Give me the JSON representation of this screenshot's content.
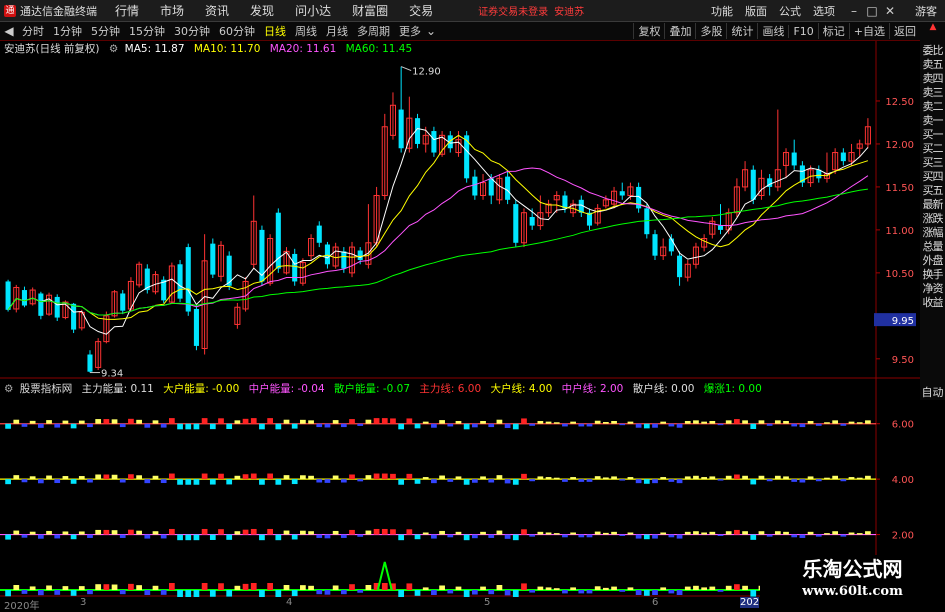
{
  "window": {
    "app_title": "通达信金融终端",
    "menus": [
      "行情",
      "市场",
      "资讯",
      "发现",
      "问小达",
      "财富圈",
      "交易"
    ],
    "notice": "证券交易未登录",
    "notice_stock": "安迪苏",
    "right_menus": [
      "功能",
      "版面",
      "公式",
      "选项"
    ],
    "guest": "游客",
    "logo_glyph": "通"
  },
  "periods": {
    "items": [
      "分时",
      "1分钟",
      "5分钟",
      "15分钟",
      "30分钟",
      "60分钟",
      "日线",
      "周线",
      "月线",
      "多周期",
      "更多"
    ],
    "active": "日线",
    "toolbar": [
      "复权",
      "叠加",
      "多股",
      "统计",
      "画线",
      "F10",
      "标记",
      "+自选",
      "返回"
    ]
  },
  "sidebar": {
    "items": [
      "委比",
      "卖五",
      "卖四",
      "卖三",
      "卖二",
      "卖一",
      "买一",
      "买二",
      "买三",
      "买四",
      "买五",
      "最新",
      "涨跌",
      "涨幅",
      "总量",
      "外盘",
      "换手",
      "净资",
      "收益"
    ],
    "auto": "自动"
  },
  "legend_main": {
    "stock": "安迪苏(日线 前复权)",
    "ma5": "MA5: 11.87",
    "ma10": "MA10: 11.70",
    "ma20": "MA20: 11.61",
    "ma60": "MA60: 11.45"
  },
  "legend_indicator": {
    "name": "股票指标网",
    "items": [
      {
        "label": "主力能量: 0.11",
        "color": "#dddddd"
      },
      {
        "label": "大户能量: -0.00",
        "color": "#ffff00"
      },
      {
        "label": "中户能量: -0.04",
        "color": "#ff55ff"
      },
      {
        "label": "散户能量: -0.07",
        "color": "#00ff00"
      },
      {
        "label": "主力线: 6.00",
        "color": "#ff3333"
      },
      {
        "label": "大户线: 4.00",
        "color": "#ffff00"
      },
      {
        "label": "中户线: 2.00",
        "color": "#ff55ff"
      },
      {
        "label": "散户线: 0.00",
        "color": "#dddddd"
      },
      {
        "label": "爆涨1: 0.00",
        "color": "#00ff00"
      }
    ]
  },
  "date_axis": [
    "2020年",
    "3",
    "4",
    "5",
    "6",
    "202"
  ],
  "watermark": {
    "line1": "乐淘公式网",
    "line2": "www.60lt.com"
  },
  "colors": {
    "up": "#ff3333",
    "down": "#00e5ff",
    "ma5": "#ffffff",
    "ma10": "#ffff00",
    "ma20": "#ff55ff",
    "ma60": "#00ff00"
  },
  "chart_data": [
    {
      "type": "candlestick",
      "title": "安迪苏(日线 前复权)",
      "y_ticks": [
        12.5,
        12.0,
        11.5,
        11.0,
        10.5,
        9.95,
        9.5
      ],
      "ylim": [
        9.3,
        13.0
      ],
      "annotations": [
        {
          "label": "12.90",
          "index": 48,
          "value": 12.9
        },
        {
          "label": "9.34",
          "index": 10,
          "value": 9.34
        }
      ],
      "current_price": "9.95",
      "candles": [
        [
          10.4,
          10.07,
          10.42,
          10.05
        ],
        [
          10.08,
          10.33,
          10.36,
          10.04
        ],
        [
          10.3,
          10.12,
          10.34,
          10.1
        ],
        [
          10.14,
          10.3,
          10.33,
          10.12
        ],
        [
          10.26,
          10.0,
          10.28,
          9.96
        ],
        [
          10.02,
          10.24,
          10.27,
          10.0
        ],
        [
          10.22,
          9.98,
          10.25,
          9.94
        ],
        [
          9.98,
          10.16,
          10.18,
          9.96
        ],
        [
          10.14,
          9.84,
          10.15,
          9.8
        ],
        [
          9.86,
          10.04,
          10.07,
          9.83
        ],
        [
          9.55,
          9.35,
          9.6,
          9.34
        ],
        [
          9.4,
          9.7,
          9.74,
          9.37
        ],
        [
          9.7,
          10.0,
          10.05,
          9.68
        ],
        [
          10.0,
          10.28,
          10.3,
          9.98
        ],
        [
          10.26,
          10.06,
          10.3,
          10.02
        ],
        [
          10.08,
          10.4,
          10.45,
          10.05
        ],
        [
          10.36,
          10.6,
          10.63,
          10.33
        ],
        [
          10.55,
          10.3,
          10.6,
          10.26
        ],
        [
          10.28,
          10.48,
          10.52,
          10.25
        ],
        [
          10.42,
          10.18,
          10.46,
          10.15
        ],
        [
          10.16,
          10.58,
          10.62,
          10.14
        ],
        [
          10.6,
          10.2,
          10.65,
          10.16
        ],
        [
          10.8,
          10.05,
          10.84,
          10.0
        ],
        [
          10.08,
          9.65,
          10.12,
          9.6
        ],
        [
          9.62,
          10.64,
          10.95,
          9.55
        ],
        [
          10.84,
          10.48,
          10.9,
          10.44
        ],
        [
          10.46,
          10.82,
          10.87,
          10.4
        ],
        [
          10.7,
          10.35,
          10.75,
          10.3
        ],
        [
          9.9,
          10.1,
          10.15,
          9.85
        ],
        [
          10.08,
          10.4,
          10.45,
          10.05
        ],
        [
          10.6,
          11.1,
          11.4,
          10.55
        ],
        [
          11.0,
          10.4,
          11.05,
          10.35
        ],
        [
          10.38,
          10.9,
          10.95,
          10.35
        ],
        [
          11.2,
          10.55,
          11.25,
          10.5
        ],
        [
          10.5,
          10.75,
          10.8,
          10.48
        ],
        [
          10.72,
          10.4,
          10.78,
          10.35
        ],
        [
          10.38,
          10.62,
          10.67,
          10.35
        ],
        [
          10.7,
          10.9,
          10.95,
          10.65
        ],
        [
          11.05,
          10.85,
          11.1,
          10.8
        ],
        [
          10.83,
          10.6,
          10.86,
          10.55
        ],
        [
          10.58,
          10.8,
          10.85,
          10.55
        ],
        [
          10.75,
          10.55,
          10.8,
          10.5
        ],
        [
          10.5,
          10.8,
          10.86,
          10.45
        ],
        [
          10.76,
          10.65,
          10.8,
          10.6
        ],
        [
          10.6,
          10.85,
          11.3,
          10.55
        ],
        [
          10.85,
          11.4,
          11.5,
          10.8
        ],
        [
          11.4,
          12.2,
          12.35,
          11.35
        ],
        [
          12.1,
          12.45,
          12.6,
          12.05
        ],
        [
          12.4,
          11.95,
          12.9,
          11.9
        ],
        [
          11.95,
          12.3,
          12.55,
          11.9
        ],
        [
          12.3,
          12.0,
          12.35,
          11.95
        ],
        [
          12.0,
          12.1,
          12.2,
          11.9
        ],
        [
          12.15,
          11.9,
          12.2,
          11.85
        ],
        [
          11.88,
          12.1,
          12.15,
          11.85
        ],
        [
          12.1,
          11.95,
          12.15,
          11.9
        ],
        [
          11.9,
          12.05,
          12.15,
          11.85
        ],
        [
          12.1,
          11.6,
          12.15,
          11.55
        ],
        [
          11.62,
          11.4,
          11.7,
          11.35
        ],
        [
          11.4,
          11.55,
          11.65,
          11.35
        ],
        [
          11.6,
          11.4,
          11.65,
          11.3
        ],
        [
          11.35,
          11.6,
          11.65,
          11.3
        ],
        [
          11.62,
          11.35,
          11.68,
          11.3
        ],
        [
          11.3,
          10.85,
          11.35,
          10.8
        ],
        [
          10.85,
          11.2,
          11.25,
          10.8
        ],
        [
          11.15,
          11.05,
          11.25,
          11.0
        ],
        [
          11.05,
          11.2,
          11.4,
          11.0
        ],
        [
          11.2,
          11.3,
          11.35,
          11.15
        ],
        [
          11.35,
          11.4,
          11.45,
          11.2
        ],
        [
          11.4,
          11.25,
          11.45,
          11.2
        ],
        [
          11.2,
          11.3,
          11.35,
          11.15
        ],
        [
          11.35,
          11.2,
          11.4,
          11.15
        ],
        [
          11.2,
          11.05,
          11.25,
          11.0
        ],
        [
          11.08,
          11.25,
          11.3,
          11.05
        ],
        [
          11.28,
          11.35,
          11.4,
          11.25
        ],
        [
          11.3,
          11.45,
          11.5,
          11.25
        ],
        [
          11.45,
          11.4,
          11.55,
          11.35
        ],
        [
          11.4,
          11.5,
          11.55,
          11.35
        ],
        [
          11.5,
          11.25,
          11.55,
          11.2
        ],
        [
          11.25,
          10.95,
          11.3,
          10.9
        ],
        [
          10.95,
          10.7,
          11.0,
          10.65
        ],
        [
          10.7,
          10.8,
          10.9,
          10.65
        ],
        [
          10.9,
          10.75,
          10.95,
          10.7
        ],
        [
          10.7,
          10.45,
          10.75,
          10.35
        ],
        [
          10.45,
          10.6,
          10.65,
          10.4
        ],
        [
          10.6,
          10.8,
          10.85,
          10.55
        ],
        [
          10.8,
          10.9,
          10.95,
          10.75
        ],
        [
          10.95,
          11.1,
          11.15,
          10.9
        ],
        [
          11.05,
          11.0,
          11.3,
          10.95
        ],
        [
          11.0,
          11.2,
          11.25,
          10.95
        ],
        [
          11.2,
          11.5,
          11.6,
          11.15
        ],
        [
          11.5,
          11.7,
          11.8,
          11.45
        ],
        [
          11.7,
          11.35,
          11.75,
          11.3
        ],
        [
          11.4,
          11.6,
          11.7,
          11.35
        ],
        [
          11.6,
          11.5,
          11.65,
          11.4
        ],
        [
          11.5,
          11.7,
          12.4,
          11.45
        ],
        [
          11.75,
          11.9,
          11.95,
          11.6
        ],
        [
          11.9,
          11.75,
          12.05,
          11.7
        ],
        [
          11.75,
          11.55,
          11.8,
          11.5
        ],
        [
          11.55,
          11.7,
          11.75,
          11.5
        ],
        [
          11.7,
          11.6,
          11.75,
          11.55
        ],
        [
          11.6,
          11.65,
          11.9,
          11.55
        ],
        [
          11.7,
          11.9,
          11.95,
          11.65
        ],
        [
          11.9,
          11.8,
          11.95,
          11.75
        ],
        [
          11.8,
          11.9,
          12.0,
          11.75
        ],
        [
          11.95,
          12.0,
          12.05,
          11.85
        ],
        [
          12.0,
          12.2,
          12.3,
          11.95
        ]
      ]
    },
    {
      "type": "bar",
      "title": "股票指标网",
      "y_ticks": [
        6.0,
        4.0,
        2.0
      ],
      "series": [
        {
          "name": "主力线",
          "baseline": 6.0
        },
        {
          "name": "大户线",
          "baseline": 4.0
        },
        {
          "name": "中户线",
          "baseline": 2.0
        },
        {
          "name": "散户线",
          "baseline": 0.0
        }
      ],
      "spike": {
        "series": "爆涨1",
        "index": 46,
        "value": 1.0
      }
    }
  ]
}
